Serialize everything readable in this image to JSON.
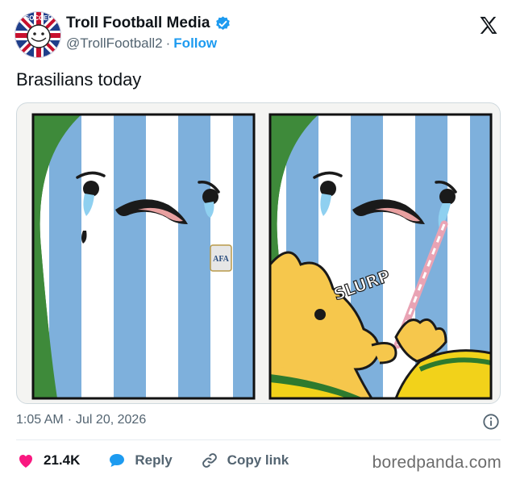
{
  "author": {
    "display_name": "Troll Football Media",
    "handle": "@TrollFootball2",
    "separator": "·",
    "follow_label": "Follow",
    "avatar_badge_text": "SOCCER"
  },
  "tweet": {
    "text": "Brasilians today",
    "time": "1:05 AM",
    "meta_separator": "·",
    "date": "Jul 20, 2026"
  },
  "media": {
    "comic_sound_effect": "SLURP",
    "badge_text": "AFA"
  },
  "actions": {
    "like_count": "21.4K",
    "reply_label": "Reply",
    "copy_link_label": "Copy link"
  },
  "watermark": "boredpanda.com",
  "colors": {
    "accent": "#1d9bf0",
    "like": "#f91880",
    "stripe_blue": "#7eb0dc",
    "brazil_yellow": "#f6c74c",
    "brazil_green": "#3e8a3a"
  }
}
